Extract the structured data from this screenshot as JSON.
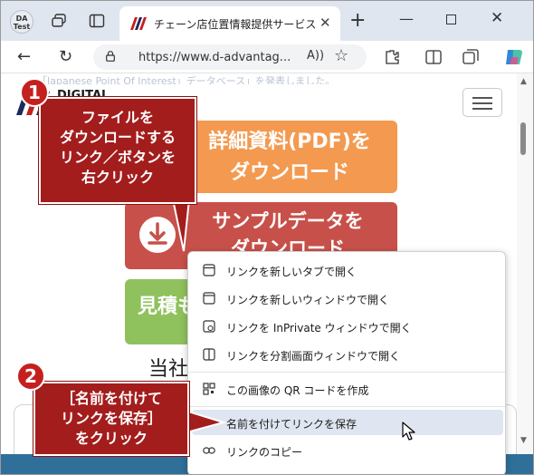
{
  "browser": {
    "avatar_label": "DA\nTest",
    "tab": {
      "title": "チェーン店位置情報提供サービス（G",
      "close": "✕"
    },
    "new_tab": "+",
    "window_controls": {
      "minimize": "—",
      "close": "✕"
    },
    "nav": {
      "back": "←",
      "refresh": "↻",
      "url": "https://www.d-advantag...",
      "read_aloud": "A))",
      "favorite": "☆"
    }
  },
  "page": {
    "banner_text": "「Japanese Point Of Interest」データベース」を発表しました。",
    "logo_text": "DIGITAL",
    "buttons": {
      "pdf": "詳細資料(PDF)を\nダウンロード",
      "sample": "サンプルデータを\nダウンロード",
      "estimate": "見積もり"
    },
    "heading_partial": "当社"
  },
  "context_menu": {
    "items": [
      {
        "label": "リンクを新しいタブで開く",
        "icon": "new-tab-icon"
      },
      {
        "label": "リンクを新しいウィンドウで開く",
        "icon": "new-window-icon"
      },
      {
        "label": "リンクを InPrivate ウィンドウで開く",
        "icon": "inprivate-icon"
      },
      {
        "label": "リンクを分割画面ウィンドウで開く",
        "icon": "split-screen-icon"
      },
      {
        "label": "この画像の QR コードを作成",
        "icon": "qr-code-icon"
      },
      {
        "label": "名前を付けてリンクを保存",
        "icon": ""
      },
      {
        "label": "リンクのコピー",
        "icon": "link-icon"
      }
    ]
  },
  "annotations": {
    "step1": {
      "number": "1",
      "text": "ファイルを\nダウンロードする\nリンク／ボタンを\n右クリック"
    },
    "step2": {
      "number": "2",
      "text": "［名前を付けて\nリンクを保存］\nをクリック"
    }
  },
  "colors": {
    "accent_red": "#c52020",
    "callout_bg": "#a31d1d",
    "pdf_button": "#f39a50",
    "sample_button": "#c8504a",
    "estimate_button": "#8fc15c",
    "menu_hover": "#dfe6f1"
  }
}
